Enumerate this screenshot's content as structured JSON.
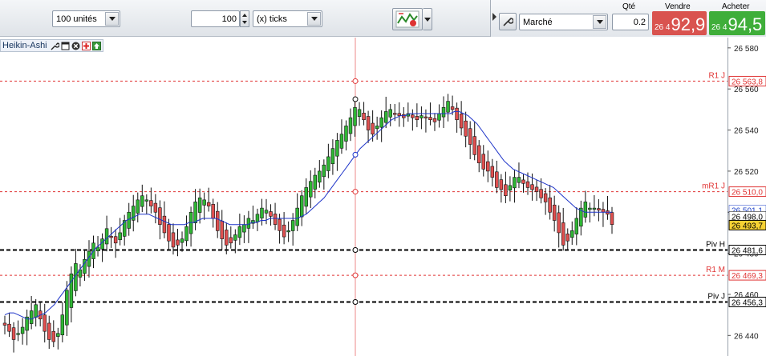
{
  "toolbar": {
    "quantity_units": "100 unités",
    "step_value": "100",
    "step_unit": "(x) ticks",
    "order_type": "Marché",
    "qty_label": "Qté",
    "qty_value": "0.2",
    "sell": {
      "label": "Vendre",
      "prefix": "26 4",
      "price": "92,9",
      "color": "#d9534f"
    },
    "buy": {
      "label": "Acheter",
      "prefix": "26 4",
      "price": "94,5",
      "color": "#3fae3a"
    }
  },
  "indicator": {
    "name": "Heikin-Ashi"
  },
  "axis": {
    "ticks": [
      "26 580",
      "26 560",
      "26 540",
      "26 520",
      "26 500",
      "26 480",
      "26 460",
      "26 440"
    ]
  },
  "levels": [
    {
      "name": "R1 J",
      "value": "26 563,8",
      "color": "#e03434",
      "style": "dotted"
    },
    {
      "name": "mR1 J",
      "value": "26 510,0",
      "color": "#e03434",
      "style": "dotted"
    },
    {
      "name": "Piv H",
      "value": "26 481,6",
      "color": "#000000",
      "style": "dashed"
    },
    {
      "name": "R1 M",
      "value": "26 469,3",
      "color": "#e03434",
      "style": "dotted"
    },
    {
      "name": "Piv J",
      "value": "26 456,3",
      "color": "#000000",
      "style": "dashed"
    }
  ],
  "price_tags": [
    {
      "value": "26 501,1",
      "color": "#1a3fc7",
      "bg": "#ffffff"
    },
    {
      "value": "26 498,0",
      "color": "#000000",
      "bg": "#ffffff"
    },
    {
      "value": "26 493,7",
      "color": "#000000",
      "bg": "#f7d233"
    }
  ],
  "chart_data": {
    "type": "candlestick",
    "style": "Heikin-Ashi",
    "ylim": [
      26430,
      26585
    ],
    "grid": false,
    "up_color": "#2fb534",
    "down_color": "#e05050",
    "ma_color": "#1f35c9",
    "closes": [
      26445,
      26442,
      26438,
      26441,
      26444,
      26449,
      26452,
      26455,
      26448,
      26442,
      26438,
      26437,
      26441,
      26450,
      26462,
      26470,
      26475,
      26472,
      26477,
      26481,
      26485,
      26483,
      26487,
      26492,
      26488,
      26485,
      26490,
      26496,
      26500,
      26503,
      26506,
      26508,
      26506,
      26503,
      26500,
      26494,
      26490,
      26486,
      26483,
      26484,
      26487,
      26493,
      26500,
      26505,
      26507,
      26506,
      26503,
      26497,
      26491,
      26487,
      26484,
      26485,
      26489,
      26493,
      26494,
      26497,
      26496,
      26499,
      26502,
      26501,
      26498,
      26494,
      26491,
      26488,
      26491,
      26496,
      26502,
      26508,
      26512,
      26515,
      26518,
      26520,
      26523,
      26527,
      26531,
      26535,
      26538,
      26542,
      26546,
      26551,
      26550,
      26545,
      26540,
      26538,
      26542,
      26546,
      26549,
      26550,
      26548,
      26547,
      26546,
      26548,
      26546,
      26545,
      26547,
      26546,
      26545,
      26544,
      26548,
      26551,
      26554,
      26550,
      26545,
      26541,
      26537,
      26533,
      26528,
      26524,
      26521,
      26520,
      26517,
      26512,
      26511,
      26508,
      26513,
      26517,
      26517,
      26514,
      26512,
      26511,
      26510,
      26507,
      26505,
      26500,
      26496,
      26490,
      26484,
      26486,
      26491,
      26497,
      26502,
      26505,
      26502,
      26502,
      26501,
      26500,
      26499,
      26494
    ],
    "ma": [
      26450,
      26451,
      26451,
      26450,
      26449,
      26448,
      26448,
      26449,
      26450,
      26451,
      26453,
      26455,
      26458,
      26461,
      26464,
      26467,
      26470,
      26473,
      26476,
      26479,
      26482,
      26484,
      26486,
      26488,
      26490,
      26492,
      26494,
      26496,
      26497,
      26498,
      26499,
      26499,
      26499,
      26498,
      26497,
      26496,
      26495,
      26494,
      26494,
      26494,
      26494,
      26495,
      26495,
      26496,
      26497,
      26497,
      26497,
      26497,
      26496,
      26495,
      26494,
      26494,
      26494,
      26494,
      26494,
      26495,
      26495,
      26496,
      26496,
      26497,
      26497,
      26497,
      26497,
      26497,
      26497,
      26497,
      26498,
      26499,
      26501,
      26503,
      26505,
      26507,
      26510,
      26513,
      26516,
      26519,
      26522,
      26525,
      26528,
      26531,
      26533,
      26535,
      26537,
      26539,
      26541,
      26543,
      26545,
      26546,
      26547,
      26547,
      26548,
      26548,
      26548,
      26548,
      26548,
      26548,
      26548,
      26548,
      26548,
      26548,
      26549,
      26549,
      26548,
      26547,
      26545,
      26543,
      26540,
      26537,
      26534,
      26531,
      26528,
      26525,
      26523,
      26521,
      26520,
      26519,
      26518,
      26517,
      26516,
      26515,
      26514,
      26513,
      26512,
      26510,
      26508,
      26506,
      26504,
      26502,
      26501,
      26500,
      26500,
      26500,
      26500,
      26500,
      26500,
      26500
    ]
  }
}
